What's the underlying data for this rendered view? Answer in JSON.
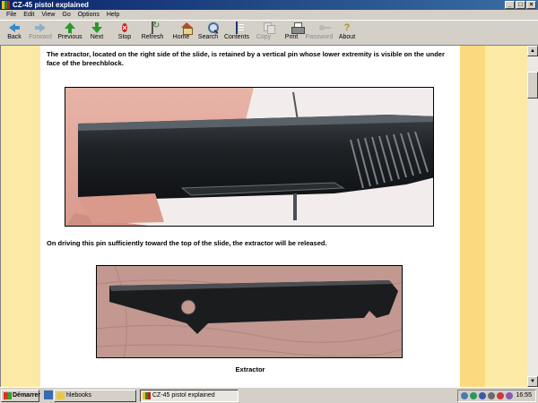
{
  "window": {
    "title": "CZ-45 pistol explained",
    "controls": {
      "minimize": "_",
      "maximize": "□",
      "close": "×"
    }
  },
  "menu": [
    "File",
    "Edit",
    "View",
    "Go",
    "Options",
    "Help"
  ],
  "toolbar": [
    {
      "label": "Back",
      "icon": "back-arrow-icon",
      "enabled": true
    },
    {
      "label": "Forward",
      "icon": "forward-arrow-icon",
      "enabled": false
    },
    {
      "label": "Previous",
      "icon": "previous-arrow-icon",
      "enabled": true
    },
    {
      "label": "Next",
      "icon": "next-arrow-icon",
      "enabled": true
    },
    {
      "label": "Stop",
      "icon": "stop-icon",
      "enabled": true
    },
    {
      "label": "Refresh",
      "icon": "refresh-icon",
      "enabled": true
    },
    {
      "label": "Home",
      "icon": "home-icon",
      "enabled": true
    },
    {
      "label": "Search",
      "icon": "search-icon",
      "enabled": true
    },
    {
      "label": "Contents",
      "icon": "contents-book-icon",
      "enabled": true
    },
    {
      "label": "Copy",
      "icon": "copy-icon",
      "enabled": false
    },
    {
      "label": "Print",
      "icon": "printer-icon",
      "enabled": true
    },
    {
      "label": "Password",
      "icon": "key-icon",
      "enabled": false
    },
    {
      "label": "About",
      "icon": "about-question-icon",
      "enabled": true
    }
  ],
  "content": {
    "paragraph1": "The extractor, located on the right side of the slide, is retained by a vertical pin whose lower extremity is visible on the under face of the breechblock.",
    "paragraph2": "On driving this pin sufficiently toward the top of the slide, the extractor will be released.",
    "caption": "Extractor"
  },
  "taskbar": {
    "start_label": "Démarrer",
    "tasks": [
      {
        "label": "hlebooks",
        "active": false
      },
      {
        "label": "CZ-45 pistol explained",
        "active": true
      }
    ],
    "clock": "16:55"
  },
  "colors": {
    "page_background": "#fde9a6",
    "content_background": "#ffffff",
    "right_band": "#fbd97f",
    "titlebar": "#0a246a"
  }
}
